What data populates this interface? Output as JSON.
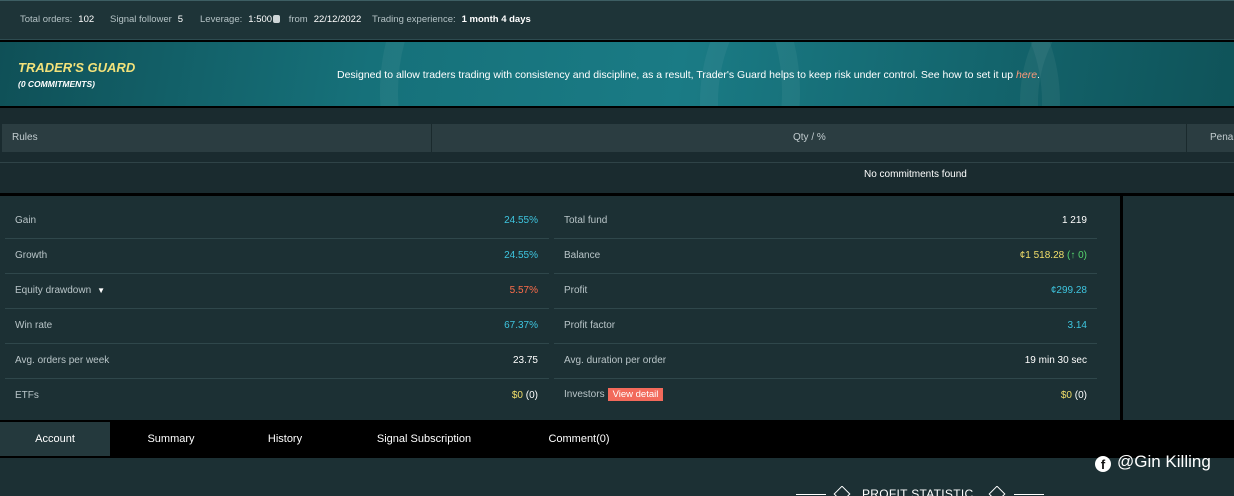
{
  "topbar": {
    "total_orders_label": "Total orders:",
    "total_orders": "102",
    "signal_follower_label": "Signal follower",
    "signal_follower": "5",
    "leverage_label": "Leverage:",
    "leverage": "1:500",
    "from_label": "from",
    "from_date": "22/12/2022",
    "experience_label": "Trading experience:",
    "experience": "1 month 4 days"
  },
  "guard": {
    "title": "TRADER'S GUARD",
    "subtitle": "(0 COMMITMENTS)",
    "description": "Designed to allow traders trading with consistency and discipline, as a result, Trader's Guard helps to keep risk under control. See how to set it up ",
    "link": "here",
    "period": "."
  },
  "rules": {
    "col_rules": "Rules",
    "col_qty": "Qty / %",
    "col_penalty": "Pena",
    "empty": "No commitments found"
  },
  "stats_left": [
    {
      "label": "Gain",
      "value": "24.55%"
    },
    {
      "label": "Growth",
      "value": "24.55%"
    },
    {
      "label": "Equity drawdown",
      "value": "5.57%"
    },
    {
      "label": "Win rate",
      "value": "67.37%"
    },
    {
      "label": "Avg. orders per week",
      "value": "23.75"
    },
    {
      "label": "ETFs",
      "value": "$0",
      "value_extra": " (0)"
    }
  ],
  "stats_right": [
    {
      "label": "Total fund",
      "value": "1 219"
    },
    {
      "label": "Balance",
      "value": "¢1 518.28",
      "value_extra": "(↑ 0)"
    },
    {
      "label": "Profit",
      "value": "¢299.28"
    },
    {
      "label": "Profit factor",
      "value": "3.14"
    },
    {
      "label": "Avg. duration per order",
      "value": "19 min 30 sec"
    },
    {
      "label": "Investors",
      "button": "View detail",
      "value": "$0",
      "value_extra": " (0)"
    }
  ],
  "tabs": [
    {
      "label": "Account",
      "active": true
    },
    {
      "label": "Summary"
    },
    {
      "label": "History"
    },
    {
      "label": "Signal Subscription"
    },
    {
      "label": "Comment(0)"
    }
  ],
  "bottom": {
    "profit_statistic": "PROFIT STATISTIC"
  },
  "watermark": "@Gin Killing",
  "icons": {
    "coins": "coins-icon",
    "dropdown": "triangle-down-icon",
    "facebook": "facebook-icon"
  },
  "colors": {
    "accent_cyan": "#3ec5df",
    "drawdown_red": "#ff6d4a",
    "money_yellow": "#f2de6a",
    "button_red": "#f26a5b"
  }
}
